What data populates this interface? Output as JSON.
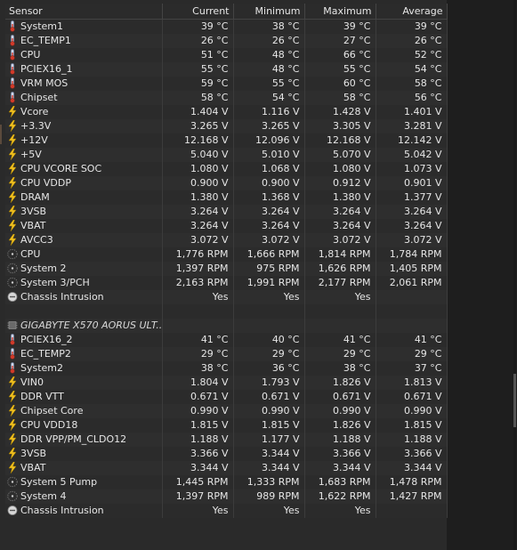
{
  "header": {
    "sensor": "Sensor",
    "current": "Current",
    "minimum": "Minimum",
    "maximum": "Maximum",
    "average": "Average"
  },
  "rows": [
    {
      "icon": "thermometer-icon",
      "name": "System1",
      "current": "39 °C",
      "minimum": "38 °C",
      "maximum": "39 °C",
      "average": "39 °C"
    },
    {
      "icon": "thermometer-icon",
      "name": "EC_TEMP1",
      "current": "26 °C",
      "minimum": "26 °C",
      "maximum": "27 °C",
      "average": "26 °C"
    },
    {
      "icon": "thermometer-icon",
      "name": "CPU",
      "current": "51 °C",
      "minimum": "48 °C",
      "maximum": "66 °C",
      "average": "52 °C"
    },
    {
      "icon": "thermometer-icon",
      "name": "PCIEX16_1",
      "current": "55 °C",
      "minimum": "48 °C",
      "maximum": "55 °C",
      "average": "54 °C"
    },
    {
      "icon": "thermometer-icon",
      "name": "VRM MOS",
      "current": "59 °C",
      "minimum": "55 °C",
      "maximum": "60 °C",
      "average": "58 °C"
    },
    {
      "icon": "thermometer-icon",
      "name": "Chipset",
      "current": "58 °C",
      "minimum": "54 °C",
      "maximum": "58 °C",
      "average": "56 °C"
    },
    {
      "icon": "lightning-icon",
      "name": "Vcore",
      "current": "1.404 V",
      "minimum": "1.116 V",
      "maximum": "1.428 V",
      "average": "1.401 V"
    },
    {
      "icon": "lightning-icon",
      "name": "+3.3V",
      "current": "3.265 V",
      "minimum": "3.265 V",
      "maximum": "3.305 V",
      "average": "3.281 V"
    },
    {
      "icon": "lightning-icon",
      "name": "+12V",
      "current": "12.168 V",
      "minimum": "12.096 V",
      "maximum": "12.168 V",
      "average": "12.142 V"
    },
    {
      "icon": "lightning-icon",
      "name": "+5V",
      "current": "5.040 V",
      "minimum": "5.010 V",
      "maximum": "5.070 V",
      "average": "5.042 V"
    },
    {
      "icon": "lightning-icon",
      "name": "CPU VCORE SOC",
      "current": "1.080 V",
      "minimum": "1.068 V",
      "maximum": "1.080 V",
      "average": "1.073 V"
    },
    {
      "icon": "lightning-icon",
      "name": "CPU VDDP",
      "current": "0.900 V",
      "minimum": "0.900 V",
      "maximum": "0.912 V",
      "average": "0.901 V"
    },
    {
      "icon": "lightning-icon",
      "name": "DRAM",
      "current": "1.380 V",
      "minimum": "1.368 V",
      "maximum": "1.380 V",
      "average": "1.377 V"
    },
    {
      "icon": "lightning-icon",
      "name": "3VSB",
      "current": "3.264 V",
      "minimum": "3.264 V",
      "maximum": "3.264 V",
      "average": "3.264 V"
    },
    {
      "icon": "lightning-icon",
      "name": "VBAT",
      "current": "3.264 V",
      "minimum": "3.264 V",
      "maximum": "3.264 V",
      "average": "3.264 V"
    },
    {
      "icon": "lightning-icon",
      "name": "AVCC3",
      "current": "3.072 V",
      "minimum": "3.072 V",
      "maximum": "3.072 V",
      "average": "3.072 V"
    },
    {
      "icon": "fan-icon",
      "name": "CPU",
      "current": "1,776 RPM",
      "minimum": "1,666 RPM",
      "maximum": "1,814 RPM",
      "average": "1,784 RPM"
    },
    {
      "icon": "fan-icon",
      "name": "System 2",
      "current": "1,397 RPM",
      "minimum": "975 RPM",
      "maximum": "1,626 RPM",
      "average": "1,405 RPM"
    },
    {
      "icon": "fan-icon",
      "name": "System 3/PCH",
      "current": "2,163 RPM",
      "minimum": "1,991 RPM",
      "maximum": "2,177 RPM",
      "average": "2,061 RPM"
    },
    {
      "icon": "intrusion-icon",
      "name": "Chassis Intrusion",
      "current": "Yes",
      "minimum": "Yes",
      "maximum": "Yes",
      "average": ""
    },
    {
      "spacer": true
    },
    {
      "icon": "chip-icon",
      "name": "GIGABYTE X570 AORUS ULT...",
      "group": true,
      "current": "",
      "minimum": "",
      "maximum": "",
      "average": ""
    },
    {
      "icon": "thermometer-icon",
      "name": "PCIEX16_2",
      "current": "41 °C",
      "minimum": "40 °C",
      "maximum": "41 °C",
      "average": "41 °C"
    },
    {
      "icon": "thermometer-icon",
      "name": "EC_TEMP2",
      "current": "29 °C",
      "minimum": "29 °C",
      "maximum": "29 °C",
      "average": "29 °C"
    },
    {
      "icon": "thermometer-icon",
      "name": "System2",
      "current": "38 °C",
      "minimum": "36 °C",
      "maximum": "38 °C",
      "average": "37 °C"
    },
    {
      "icon": "lightning-icon",
      "name": "VIN0",
      "current": "1.804 V",
      "minimum": "1.793 V",
      "maximum": "1.826 V",
      "average": "1.813 V"
    },
    {
      "icon": "lightning-icon",
      "name": "DDR VTT",
      "current": "0.671 V",
      "minimum": "0.671 V",
      "maximum": "0.671 V",
      "average": "0.671 V"
    },
    {
      "icon": "lightning-icon",
      "name": "Chipset Core",
      "current": "0.990 V",
      "minimum": "0.990 V",
      "maximum": "0.990 V",
      "average": "0.990 V"
    },
    {
      "icon": "lightning-icon",
      "name": "CPU VDD18",
      "current": "1.815 V",
      "minimum": "1.815 V",
      "maximum": "1.826 V",
      "average": "1.815 V"
    },
    {
      "icon": "lightning-icon",
      "name": "DDR VPP/PM_CLDO12",
      "current": "1.188 V",
      "minimum": "1.177 V",
      "maximum": "1.188 V",
      "average": "1.188 V"
    },
    {
      "icon": "lightning-icon",
      "name": "3VSB",
      "current": "3.366 V",
      "minimum": "3.344 V",
      "maximum": "3.366 V",
      "average": "3.366 V"
    },
    {
      "icon": "lightning-icon",
      "name": "VBAT",
      "current": "3.344 V",
      "minimum": "3.344 V",
      "maximum": "3.344 V",
      "average": "3.344 V"
    },
    {
      "icon": "fan-icon",
      "name": "System 5 Pump",
      "current": "1,445 RPM",
      "minimum": "1,333 RPM",
      "maximum": "1,683 RPM",
      "average": "1,478 RPM"
    },
    {
      "icon": "fan-icon",
      "name": "System 4",
      "current": "1,397 RPM",
      "minimum": "989 RPM",
      "maximum": "1,622 RPM",
      "average": "1,427 RPM"
    },
    {
      "icon": "intrusion-icon",
      "name": "Chassis Intrusion",
      "current": "Yes",
      "minimum": "Yes",
      "maximum": "Yes",
      "average": ""
    }
  ]
}
